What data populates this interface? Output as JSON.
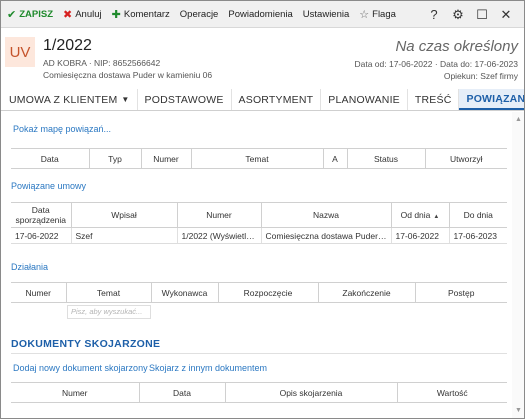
{
  "toolbar": {
    "save": "ZAPISZ",
    "cancel": "Anuluj",
    "comment": "Komentarz",
    "operations": "Operacje",
    "notifications": "Powiadomienia",
    "settings": "Ustawienia",
    "flag": "Flaga",
    "help": "?",
    "gear": "⚙",
    "maximize": "☐",
    "close": "✕"
  },
  "header": {
    "badge": "UV",
    "title": "1/2022",
    "line1": "AD KOBRA  ·  NIP: 8652566642",
    "line2": "Comiesięczna dostawa Puder w kamieniu 06",
    "status": "Na czas określony",
    "dates": "Data od: 17-06-2022  ·  Data do: 17-06-2023",
    "owner": "Opiekun: Szef firmy"
  },
  "tabs": {
    "contract": "UMOWA Z KLIENTEM",
    "basic": "PODSTAWOWE",
    "assortment": "ASORTYMENT",
    "planning": "PLANOWANIE",
    "content": "TREŚĆ",
    "relations": "POWIĄZANIA"
  },
  "links": {
    "show_map": "Pokaż mapę powiązań...",
    "related_contracts": "Powiązane umowy",
    "actions": "Działania",
    "add_doc": "Dodaj nowy dokument skojarzony",
    "link_doc": "Skojarz z innym dokumentem"
  },
  "table1": {
    "headers": [
      "Data",
      "Typ",
      "Numer",
      "Temat",
      "A",
      "Status",
      "Utworzył"
    ]
  },
  "table2": {
    "headers": [
      "Data sporządzenia",
      "Wpisał",
      "Numer",
      "Nazwa",
      "Od dnia",
      "Do dnia"
    ],
    "rows": [
      [
        "17-06-2022",
        "Szef",
        "1/2022 (Wyświetla...",
        "Comiesięczna dostawa Puder w...",
        "17-06-2022",
        "17-06-2023"
      ]
    ]
  },
  "table3": {
    "headers": [
      "Numer",
      "Temat",
      "Wykonawca",
      "Rozpoczęcie",
      "Zakończenie",
      "Postęp"
    ],
    "filter_placeholder": "Pisz, aby wyszukać..."
  },
  "linked_docs": {
    "title": "DOKUMENTY SKOJARZONE",
    "headers": [
      "Numer",
      "Data",
      "Opis skojarzenia",
      "Wartość"
    ]
  }
}
